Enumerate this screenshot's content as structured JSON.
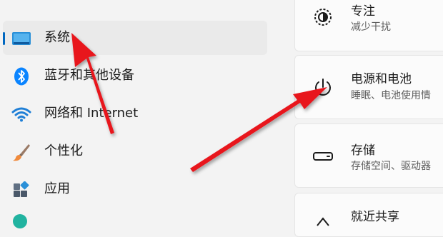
{
  "sidebar": {
    "items": [
      {
        "label": "系统",
        "icon": "display-icon",
        "active": true
      },
      {
        "label": "蓝牙和其他设备",
        "icon": "bluetooth-icon"
      },
      {
        "label": "网络和 Internet",
        "icon": "wifi-icon"
      },
      {
        "label": "个性化",
        "icon": "paintbrush-icon"
      },
      {
        "label": "应用",
        "icon": "apps-icon"
      }
    ]
  },
  "cards": [
    {
      "title": "专注",
      "subtitle": "减少干扰",
      "icon": "focus-icon"
    },
    {
      "title": "电源和电池",
      "subtitle": "睡眠、电池使用情",
      "icon": "power-icon"
    },
    {
      "title": "存储",
      "subtitle": "存储空间、驱动器",
      "icon": "storage-icon"
    },
    {
      "title": "就近共享",
      "subtitle": "",
      "icon": "nearby-share-icon"
    }
  ],
  "colors": {
    "accent": "#0067c0",
    "bluetooth": "#0a84ff",
    "arrow": "#e8141e"
  }
}
